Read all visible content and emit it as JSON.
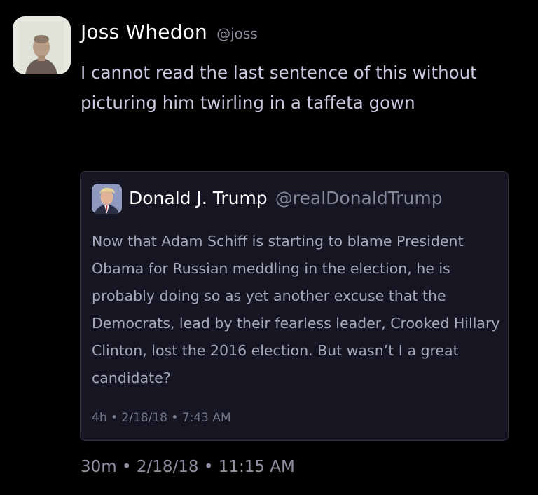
{
  "tweet": {
    "author_name": "Joss Whedon",
    "author_handle": "@joss",
    "text": "I cannot read the last sentence of this without picturing him twirling in a taffeta gown",
    "timestamp": "30m • 2/18/18 • 11:15 AM"
  },
  "quoted_tweet": {
    "author_name": "Donald J. Trump",
    "author_handle": "@realDonaldTrump",
    "text": "Now that Adam Schiff is starting to blame President Obama for Russian meddling in the election, he is probably doing so as yet another excuse that the Democrats, lead by their fearless leader, Crooked Hillary Clinton, lost the 2016 election. But wasn’t I a great candidate?",
    "timestamp": "4h • 2/18/18 • 7:43 AM"
  },
  "colors": {
    "background": "#000000",
    "quote_background": "#161622",
    "body_text": "#c9c9df",
    "secondary_text": "#8f91a2"
  },
  "icons": {
    "author_avatar": "avatar",
    "quoted_author_avatar": "avatar"
  }
}
